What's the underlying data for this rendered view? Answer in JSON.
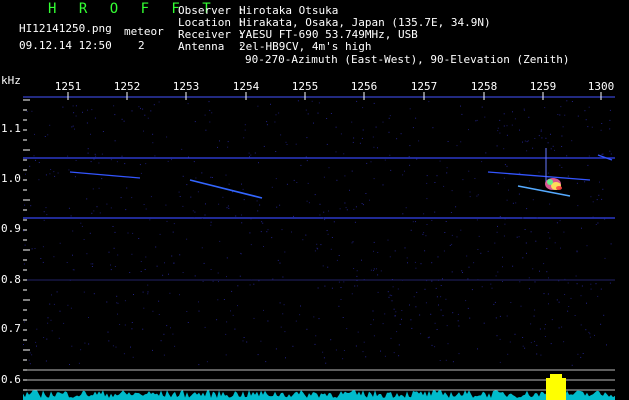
{
  "header": {
    "title": "H R O F F T",
    "filename": "HI12141250.png",
    "datetime": "09.12.14 12:50",
    "meteor_label": "meteor",
    "meteor_count": "2"
  },
  "info": {
    "observer_label": "Observer :",
    "observer": "Hirotaka Otsuka",
    "location_label": "Location :",
    "location": "Hirakata, Osaka, Japan (135.7E, 34.9N)",
    "receiver_label": "Receiver :",
    "receiver": "YAESU FT-690 53.749MHz, USB",
    "antenna_label": "Antenna  :",
    "antenna": "2el-HB9CV, 4m's high",
    "antenna_detail": "90-270-Azimuth (East-West), 90-Elevation (Zenith)"
  },
  "axes": {
    "y_unit": "kHz",
    "x_ticks": [
      "1251",
      "1252",
      "1253",
      "1254",
      "1255",
      "1256",
      "1257",
      "1258",
      "1259",
      "1300"
    ],
    "y_ticks": [
      "1.1",
      "1.0",
      "0.9",
      "0.8",
      "0.7",
      "0.6"
    ]
  },
  "colors": {
    "title": "#33ff33",
    "trace": "#3355ff",
    "noise": "#00cccc",
    "burst": "#ffff00"
  }
}
